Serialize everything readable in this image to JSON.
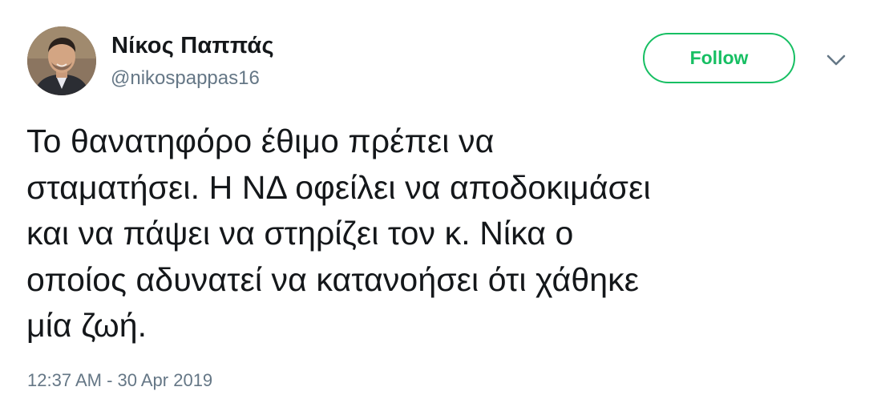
{
  "author": {
    "display_name": "Νίκος Παππάς",
    "handle": "@nikospappas16",
    "avatar_icon": "profile-photo"
  },
  "follow_button": {
    "label": "Follow",
    "color": "#17bf63"
  },
  "menu_icon": "chevron-down-icon",
  "tweet": {
    "lines": [
      "Το θανατηφόρο έθιμο πρέπει να",
      "σταματήσει. Η ΝΔ οφείλει να αποδοκιμάσει",
      "και να πάψει να στηρίζει τον κ. Νίκα ο",
      "οποίος αδυνατεί να κατανοήσει ότι χάθηκε",
      "μία ζωή."
    ]
  },
  "timestamp": "12:37 AM - 30 Apr 2019",
  "colors": {
    "text": "#14171a",
    "secondary": "#657786",
    "accent": "#17bf63"
  }
}
